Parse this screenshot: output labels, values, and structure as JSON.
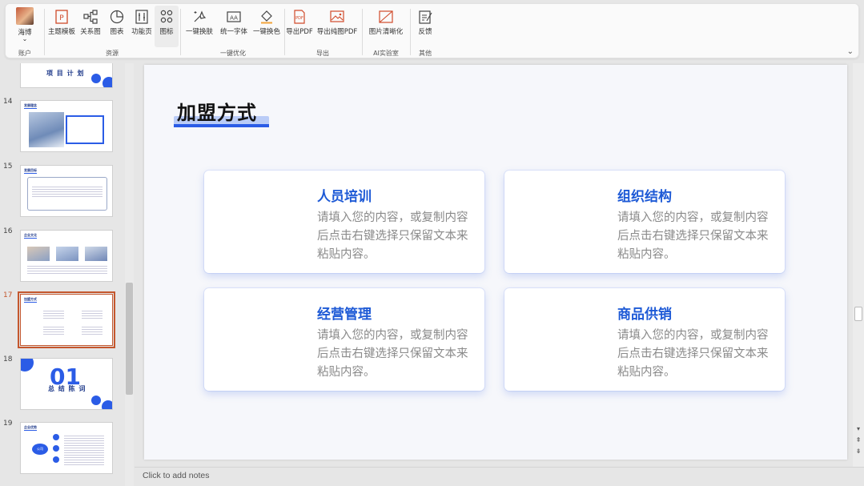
{
  "ribbon": {
    "account": {
      "name": "海博",
      "chevron": "⌄",
      "group_label": "账户"
    },
    "resources": {
      "group_label": "资源",
      "buttons": [
        {
          "label": "主题模板",
          "icon": "template-icon"
        },
        {
          "label": "关系图",
          "icon": "relation-icon"
        },
        {
          "label": "图表",
          "icon": "chart-icon"
        },
        {
          "label": "功能页",
          "icon": "feature-page-icon"
        },
        {
          "label": "图标",
          "icon": "icons-icon"
        }
      ]
    },
    "optimize": {
      "group_label": "一键优化",
      "buttons": [
        {
          "label": "一键换肤",
          "icon": "skin-icon"
        },
        {
          "label": "统一字体",
          "icon": "font-icon"
        },
        {
          "label": "一键换色",
          "icon": "paint-bucket-icon"
        }
      ]
    },
    "export": {
      "group_label": "导出",
      "buttons": [
        {
          "label": "导出PDF",
          "icon": "pdf-icon"
        },
        {
          "label": "导出纯图PDF",
          "icon": "image-pdf-icon"
        }
      ]
    },
    "ai": {
      "group_label": "AI实验室",
      "buttons": [
        {
          "label": "图片清晰化",
          "icon": "image-clarify-icon"
        }
      ]
    },
    "other": {
      "group_label": "其他",
      "buttons": [
        {
          "label": "反馈",
          "icon": "feedback-icon"
        }
      ]
    }
  },
  "thumbnails": [
    {
      "number": "",
      "title": "项 目 计 划"
    },
    {
      "number": "14",
      "title": "发展理念"
    },
    {
      "number": "15",
      "title": "发展目标"
    },
    {
      "number": "16",
      "title": "企业文化"
    },
    {
      "number": "17",
      "title": "加盟方式"
    },
    {
      "number": "18",
      "title": "总 结 陈 词",
      "big": "01"
    },
    {
      "number": "19",
      "title": "企业优势",
      "center": "公司"
    }
  ],
  "slide": {
    "title": "加盟方式",
    "cards": [
      {
        "title": "人员培训",
        "body": "请填入您的内容，或复制内容后点击右键选择只保留文本来粘贴内容。"
      },
      {
        "title": "组织结构",
        "body": "请填入您的内容，或复制内容后点击右键选择只保留文本来粘贴内容。"
      },
      {
        "title": "经营管理",
        "body": "请填入您的内容，或复制内容后点击右键选择只保留文本来粘贴内容。"
      },
      {
        "title": "商品供销",
        "body": "请填入您的内容，或复制内容后点击右键选择只保留文本来粘贴内容。"
      }
    ]
  },
  "notes": {
    "placeholder": "Click to add notes"
  },
  "colors": {
    "accent": "#1e5ad6",
    "current_slide": "#c4572e",
    "card_text": "#8a8a8a"
  }
}
